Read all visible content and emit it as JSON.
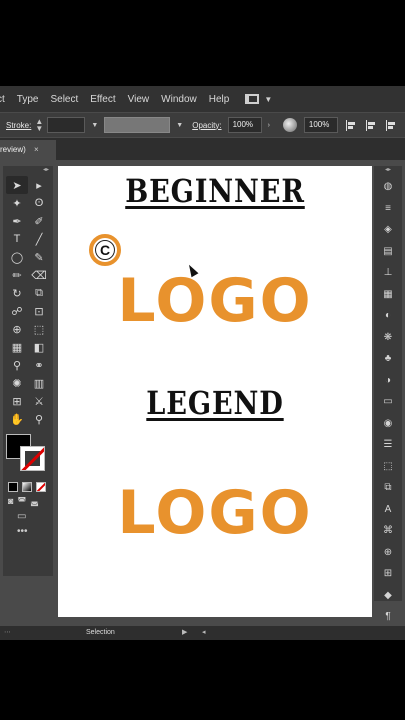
{
  "menu": {
    "items": [
      "ct",
      "Type",
      "Select",
      "Effect",
      "View",
      "Window",
      "Help"
    ]
  },
  "control_bar": {
    "stroke_label": "Stroke:",
    "opacity_label": "Opacity:",
    "opacity_value": "100%",
    "zoom_value": "100%"
  },
  "document_tab": {
    "label": "review)",
    "close": "×"
  },
  "artboard": {
    "heading_top": "BEGINNER",
    "logo_top": "LOGO",
    "badge_letter": "C",
    "heading_bottom": "LEGEND",
    "logo_bottom": "LOGO"
  },
  "status_bar": {
    "tool": "Selection"
  },
  "colors": {
    "logo_orange": "#e8922d",
    "app_bg": "#4a4a4a",
    "menubar_bg": "#323232"
  }
}
